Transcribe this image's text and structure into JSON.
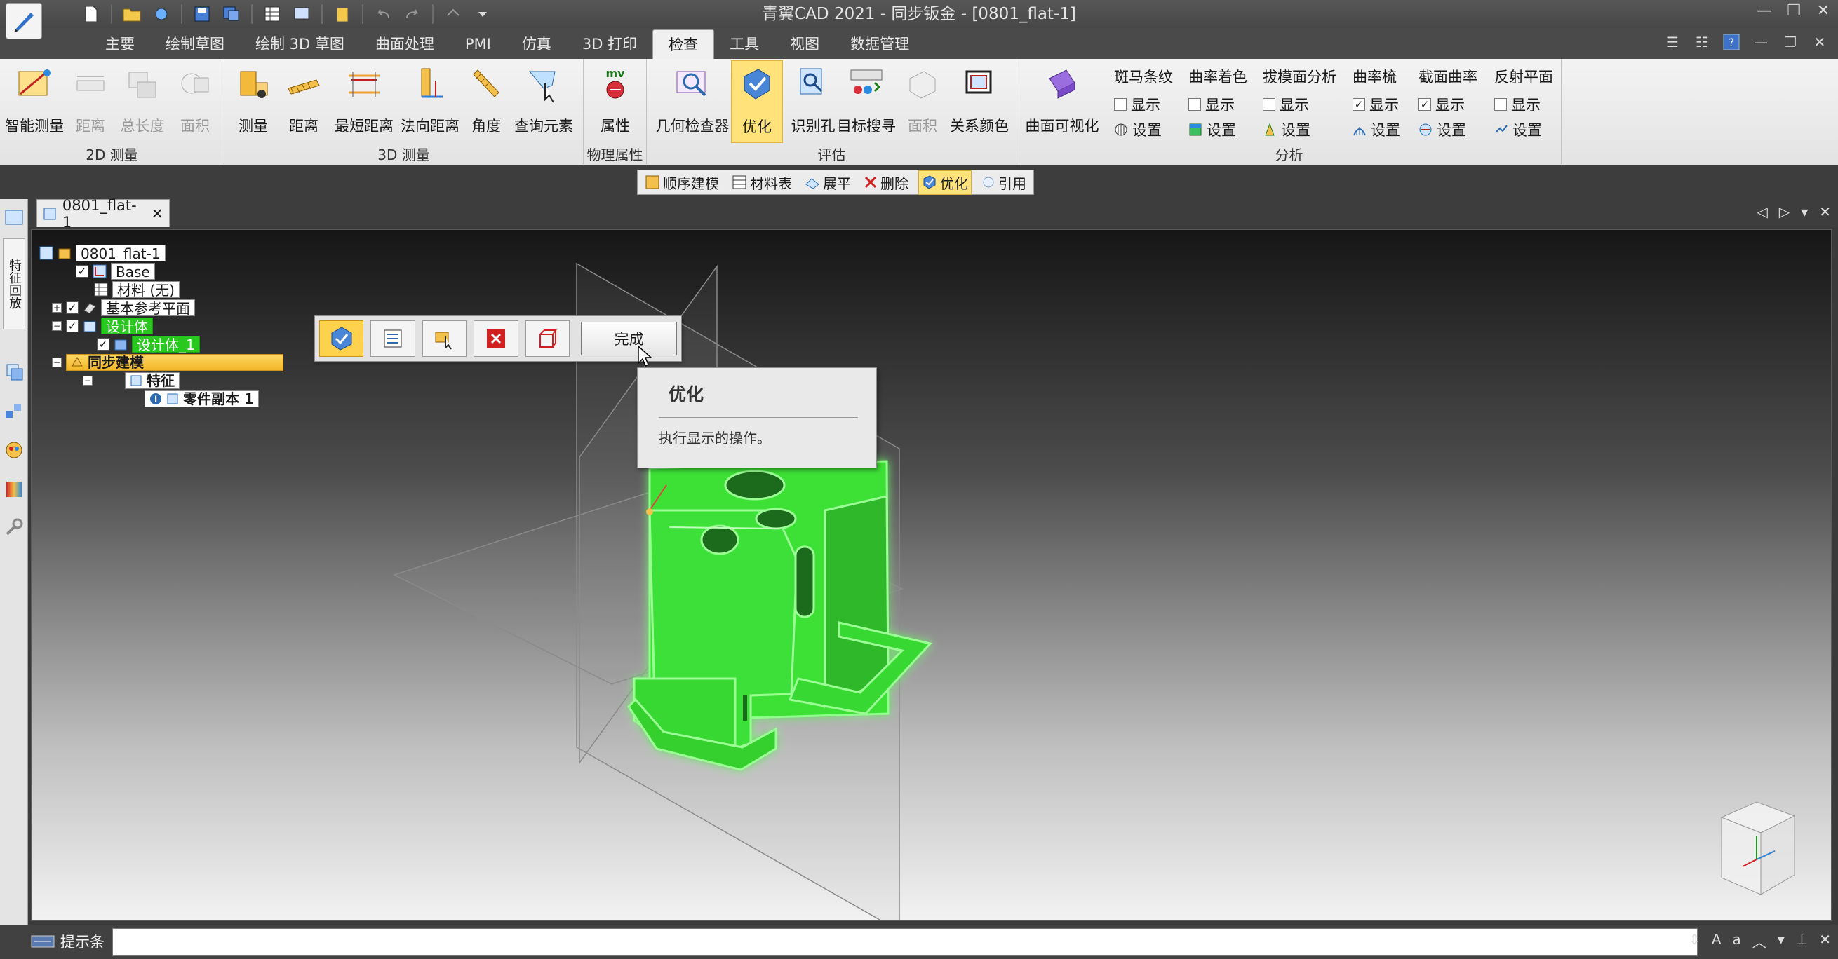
{
  "window": {
    "title": "青翼CAD 2021 - 同步钣金 - [0801_flat-1]",
    "controls": [
      "—",
      "❐",
      "✕"
    ]
  },
  "ribbon_tabs": [
    {
      "label": "主要",
      "active": false
    },
    {
      "label": "绘制草图",
      "active": false
    },
    {
      "label": "绘制 3D 草图",
      "active": false
    },
    {
      "label": "曲面处理",
      "active": false
    },
    {
      "label": "PMI",
      "active": false
    },
    {
      "label": "仿真",
      "active": false
    },
    {
      "label": "3D 打印",
      "active": false
    },
    {
      "label": "检查",
      "active": true
    },
    {
      "label": "工具",
      "active": false
    },
    {
      "label": "视图",
      "active": false
    },
    {
      "label": "数据管理",
      "active": false
    }
  ],
  "ribbon": {
    "group_2d": {
      "label": "2D 测量",
      "buttons": [
        {
          "label": "智能测量",
          "icon": "smart-measure-icon",
          "disabled": false
        },
        {
          "label": "距离",
          "icon": "distance-icon",
          "disabled": true
        },
        {
          "label": "总长度",
          "icon": "total-length-icon",
          "disabled": true
        },
        {
          "label": "面积",
          "icon": "area-icon",
          "disabled": true
        }
      ]
    },
    "group_3d": {
      "label": "3D 测量",
      "buttons": [
        {
          "label": "测量",
          "icon": "measure-icon"
        },
        {
          "label": "距离",
          "icon": "distance-icon"
        },
        {
          "label": "最短距离",
          "icon": "shortest-distance-icon"
        },
        {
          "label": "法向距离",
          "icon": "normal-distance-icon"
        },
        {
          "label": "角度",
          "icon": "angle-icon"
        },
        {
          "label": "查询元素",
          "icon": "query-element-icon"
        }
      ]
    },
    "group_phys": {
      "label": "物理属性",
      "buttons": [
        {
          "label": "属性",
          "icon": "properties-icon"
        }
      ]
    },
    "group_eval": {
      "label": "评估",
      "buttons": [
        {
          "label": "几何检查器",
          "icon": "geometry-inspector-icon",
          "active": false,
          "disabled": false
        },
        {
          "label": "优化",
          "icon": "optimize-icon",
          "active": true,
          "disabled": false
        },
        {
          "label": "识别孔",
          "icon": "recognize-hole-icon",
          "active": false,
          "disabled": false
        },
        {
          "label": "目标搜寻",
          "icon": "goal-seek-icon",
          "active": false,
          "disabled": false
        },
        {
          "label": "面积",
          "icon": "area-icon",
          "active": false,
          "disabled": true
        },
        {
          "label": "关系颜色",
          "icon": "relation-color-icon",
          "active": false,
          "disabled": false
        }
      ]
    },
    "group_analysis": {
      "label": "分析",
      "surface_vis": {
        "label": "曲面可视化",
        "icon": "surface-visualization-icon"
      },
      "subgroups": [
        {
          "title": "斑马条纹",
          "show": "显示",
          "show_checked": false,
          "settings": "设置"
        },
        {
          "title": "曲率着色",
          "show": "显示",
          "show_checked": false,
          "settings": "设置"
        },
        {
          "title": "拔模面分析",
          "show": "显示",
          "show_checked": false,
          "settings": "设置"
        },
        {
          "title": "曲率梳",
          "show": "显示",
          "show_checked": true,
          "settings": "设置"
        },
        {
          "title": "截面曲率",
          "show": "显示",
          "show_checked": true,
          "settings": "设置"
        },
        {
          "title": "反射平面",
          "show": "显示",
          "show_checked": false,
          "settings": "设置"
        }
      ]
    }
  },
  "command_bar": [
    {
      "label": "顺序建模",
      "icon": "ordered-modeling-icon",
      "active": false
    },
    {
      "label": "材料表",
      "icon": "material-table-icon",
      "active": false
    },
    {
      "label": "展平",
      "icon": "flatten-icon",
      "active": false
    },
    {
      "label": "删除",
      "icon": "delete-icon",
      "active": false
    },
    {
      "label": "优化",
      "icon": "optimize-icon",
      "active": true
    },
    {
      "label": "引用",
      "icon": "reference-icon",
      "active": false
    }
  ],
  "left_panel": {
    "vertical_tab": "特征回放"
  },
  "document_tab": {
    "label": "0801_flat-1",
    "close": "✕"
  },
  "tree": {
    "root": "0801_flat-1",
    "base": "Base",
    "material": "材料 (无)",
    "ref_planes": "基本参考平面",
    "design_body": "设计体",
    "design_body_child": "设计体_1",
    "sync_modeling": "同步建模",
    "features": "特征",
    "part_copy": "零件副本 1"
  },
  "floating_bar": {
    "done_label": "完成"
  },
  "tooltip": {
    "title": "优化",
    "body": "执行显示的操作。"
  },
  "status_bar": {
    "label": "提示条",
    "prompt_value": ""
  },
  "colors": {
    "part_green": "#39e632",
    "highlight_gold": "#f2b72a",
    "active_yellow": "#ffe27a"
  }
}
